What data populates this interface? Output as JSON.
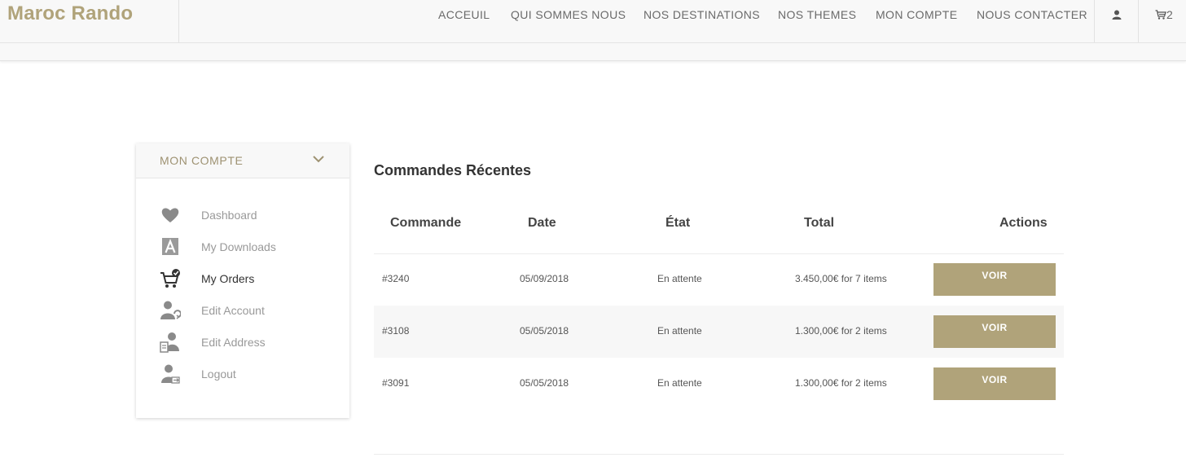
{
  "header": {
    "brand": "Maroc Rando",
    "nav": [
      "ACCEUIL",
      "QUI SOMMES NOUS",
      "NOS DESTINATIONS",
      "NOS THEMES",
      "MON COMPTE",
      "NOUS CONTACTER"
    ],
    "user_icon": "user-icon",
    "cart_icon": "cart-icon",
    "cart_count": "2"
  },
  "sidebar": {
    "title": "MON COMPTE",
    "items": [
      {
        "label": "Dashboard",
        "icon": "heart-icon"
      },
      {
        "label": "My Downloads",
        "icon": "downloads-icon"
      },
      {
        "label": "My Orders",
        "icon": "orders-cart-icon",
        "active": true
      },
      {
        "label": "Edit Account",
        "icon": "edit-account-icon"
      },
      {
        "label": "Edit Address",
        "icon": "edit-address-icon"
      },
      {
        "label": "Logout",
        "icon": "logout-icon"
      }
    ]
  },
  "orders": {
    "title": "Commandes Récentes",
    "columns": [
      "Commande",
      "Date",
      "État",
      "Total",
      "Actions"
    ],
    "rows": [
      {
        "order": "#3240",
        "date": "05/09/2018",
        "status": "En attente",
        "total": "3.450,00€ for 7 items",
        "action": "VOIR"
      },
      {
        "order": "#3108",
        "date": "05/05/2018",
        "status": "En attente",
        "total": "1.300,00€ for 2 items",
        "action": "VOIR"
      },
      {
        "order": "#3091",
        "date": "05/05/2018",
        "status": "En attente",
        "total": "1.300,00€ for 2 items",
        "action": "VOIR"
      }
    ]
  },
  "colors": {
    "accent": "#b0a37a",
    "header_bg": "#f8f8f8",
    "row_alt": "#f7f7f7"
  }
}
